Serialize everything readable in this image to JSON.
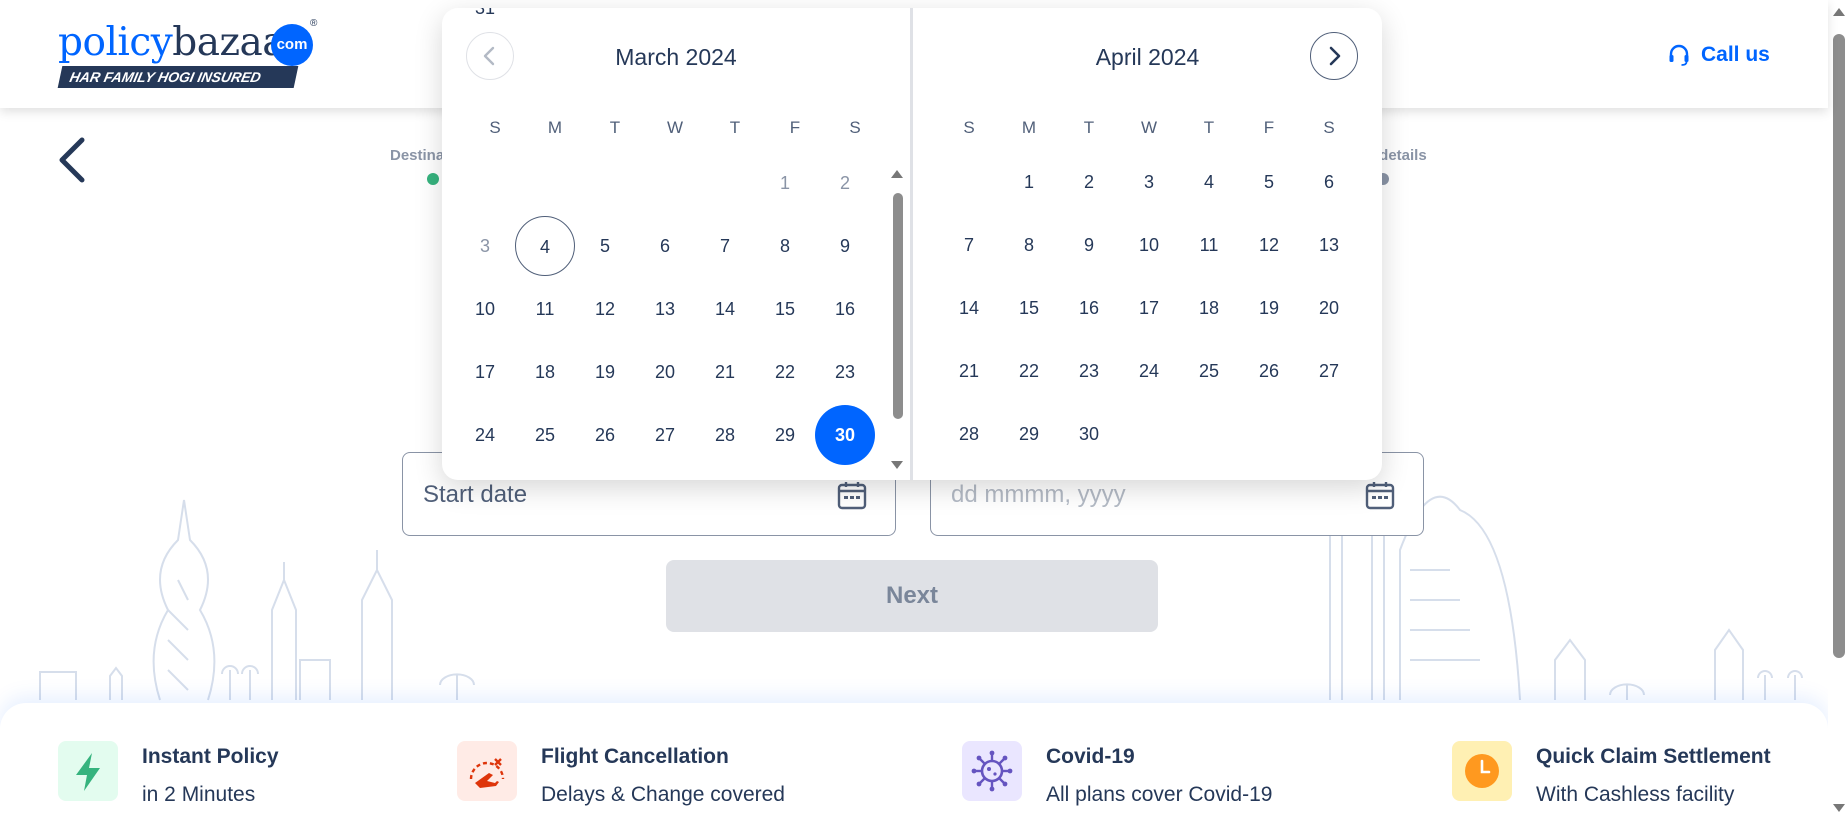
{
  "brand": {
    "name_part1": "policy",
    "name_part2": "bazaar",
    "com": "com",
    "registered": "®",
    "tagline": "HAR FAMILY HOGI INSURED"
  },
  "header": {
    "call_us": "Call us"
  },
  "progress": {
    "steps": [
      {
        "label": "Destina",
        "color": "#36b37e"
      },
      {
        "label": "t details",
        "color": "#8a94a6"
      }
    ]
  },
  "date_picker": {
    "weekday_headers": [
      "S",
      "M",
      "T",
      "W",
      "T",
      "F",
      "S"
    ],
    "months": [
      {
        "title": "March 2024",
        "first_weekday": 5,
        "days": 31,
        "disabled_days": [
          1,
          2,
          3
        ],
        "today": 4,
        "selected": 30
      },
      {
        "title": "April 2024",
        "first_weekday": 1,
        "days": 30
      }
    ]
  },
  "form": {
    "start_date": {
      "value": "Start date"
    },
    "end_date": {
      "placeholder": "dd mmmm, yyyy"
    },
    "next_label": "Next"
  },
  "features": [
    {
      "title": "Instant Policy",
      "subtitle": "in 2 Minutes",
      "icon": "lightning-icon",
      "icon_bg": "#e3fcef",
      "icon_color": "#36b37e"
    },
    {
      "title": "Flight Cancellation",
      "subtitle": "Delays & Change covered",
      "icon": "flight-cancel-icon",
      "icon_bg": "#ffebe6",
      "icon_color": "#de350b"
    },
    {
      "title": "Covid-19",
      "subtitle": "All plans cover Covid-19",
      "icon": "virus-icon",
      "icon_bg": "#eae6ff",
      "icon_color": "#6554c0"
    },
    {
      "title": "Quick Claim Settlement",
      "subtitle": "With Cashless facility",
      "icon": "clock-icon",
      "icon_bg": "#fff0b3",
      "icon_color": "#ff991f"
    }
  ],
  "colors": {
    "brand_blue": "#0065ff",
    "navy": "#253858",
    "disabled_button": "#dfe1e6"
  }
}
